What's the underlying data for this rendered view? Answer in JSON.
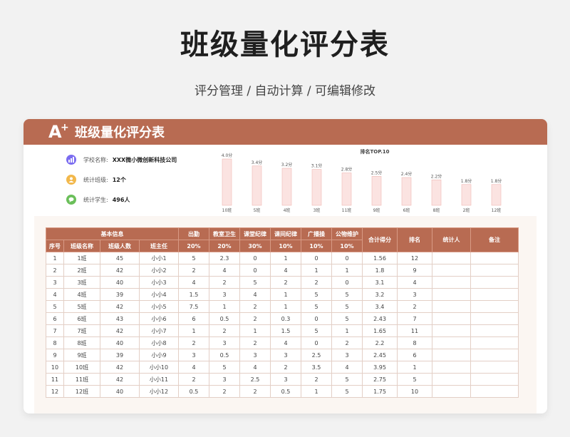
{
  "hero": {
    "title": "班级量化评分表",
    "subtitle": "评分管理 / 自动计算 / 可编辑修改"
  },
  "card": {
    "header_title": "班级量化评分表",
    "logo_letter": "A",
    "logo_plus": "+"
  },
  "info": {
    "school_label": "学校名称:",
    "school_value": "XXX微小微创新科技公司",
    "class_label": "统计班级:",
    "class_value": "12个",
    "student_label": "统计学生:",
    "student_value": "496人",
    "colors": {
      "school_icon": "#7b6cf0",
      "class_icon": "#f2b84b",
      "student_icon": "#6bbf5a"
    },
    "icons": [
      "bar-chart-icon",
      "user-icon",
      "chat-icon"
    ]
  },
  "chart_data": {
    "type": "bar",
    "title": "排名TOP.10",
    "categories": [
      "10班",
      "5班",
      "4班",
      "3班",
      "11班",
      "9班",
      "6班",
      "8班",
      "2班",
      "12班"
    ],
    "values": [
      4.0,
      3.4,
      3.2,
      3.1,
      2.8,
      2.5,
      2.4,
      2.2,
      1.8,
      1.8
    ],
    "labels": [
      "4.0分",
      "3.4分",
      "3.2分",
      "3.1分",
      "2.8分",
      "2.5分",
      "2.4分",
      "2.2分",
      "1.8分",
      "1.8分"
    ],
    "ylim": [
      0,
      4.0
    ],
    "colors": {
      "fill": "#fbe3e1",
      "stroke": "#f0b9b4"
    }
  },
  "table": {
    "group_basic": "基本信息",
    "col_groups": [
      "出勤",
      "教室卫生",
      "课堂纪律",
      "课间纪律",
      "广播操",
      "公物维护"
    ],
    "weights": [
      "20%",
      "20%",
      "30%",
      "10%",
      "10%",
      "10%"
    ],
    "basic_cols": [
      "序号",
      "班级名称",
      "班级人数",
      "班主任"
    ],
    "tail_cols": [
      "合计得分",
      "排名",
      "统计人",
      "备注"
    ],
    "rows": [
      [
        "1",
        "1班",
        "45",
        "小小1",
        "5",
        "2.3",
        "0",
        "1",
        "0",
        "0",
        "1.56",
        "12",
        "",
        ""
      ],
      [
        "2",
        "2班",
        "42",
        "小小2",
        "2",
        "4",
        "0",
        "4",
        "1",
        "1",
        "1.8",
        "9",
        "",
        ""
      ],
      [
        "3",
        "3班",
        "40",
        "小小3",
        "4",
        "2",
        "5",
        "2",
        "2",
        "0",
        "3.1",
        "4",
        "",
        ""
      ],
      [
        "4",
        "4班",
        "39",
        "小小4",
        "1.5",
        "3",
        "4",
        "1",
        "5",
        "5",
        "3.2",
        "3",
        "",
        ""
      ],
      [
        "5",
        "5班",
        "42",
        "小小5",
        "7.5",
        "1",
        "2",
        "1",
        "5",
        "5",
        "3.4",
        "2",
        "",
        ""
      ],
      [
        "6",
        "6班",
        "43",
        "小小6",
        "6",
        "0.5",
        "2",
        "0.3",
        "0",
        "5",
        "2.43",
        "7",
        "",
        ""
      ],
      [
        "7",
        "7班",
        "42",
        "小小7",
        "1",
        "2",
        "1",
        "1.5",
        "5",
        "1",
        "1.65",
        "11",
        "",
        ""
      ],
      [
        "8",
        "8班",
        "40",
        "小小8",
        "2",
        "3",
        "2",
        "4",
        "0",
        "2",
        "2.2",
        "8",
        "",
        ""
      ],
      [
        "9",
        "9班",
        "39",
        "小小9",
        "3",
        "0.5",
        "3",
        "3",
        "2.5",
        "3",
        "2.45",
        "6",
        "",
        ""
      ],
      [
        "10",
        "10班",
        "42",
        "小小10",
        "4",
        "5",
        "4",
        "2",
        "3.5",
        "4",
        "3.95",
        "1",
        "",
        ""
      ],
      [
        "11",
        "11班",
        "42",
        "小小11",
        "2",
        "3",
        "2.5",
        "3",
        "2",
        "5",
        "2.75",
        "5",
        "",
        ""
      ],
      [
        "12",
        "12班",
        "40",
        "小小12",
        "0.5",
        "2",
        "2",
        "0.5",
        "1",
        "5",
        "1.75",
        "10",
        "",
        ""
      ]
    ]
  }
}
